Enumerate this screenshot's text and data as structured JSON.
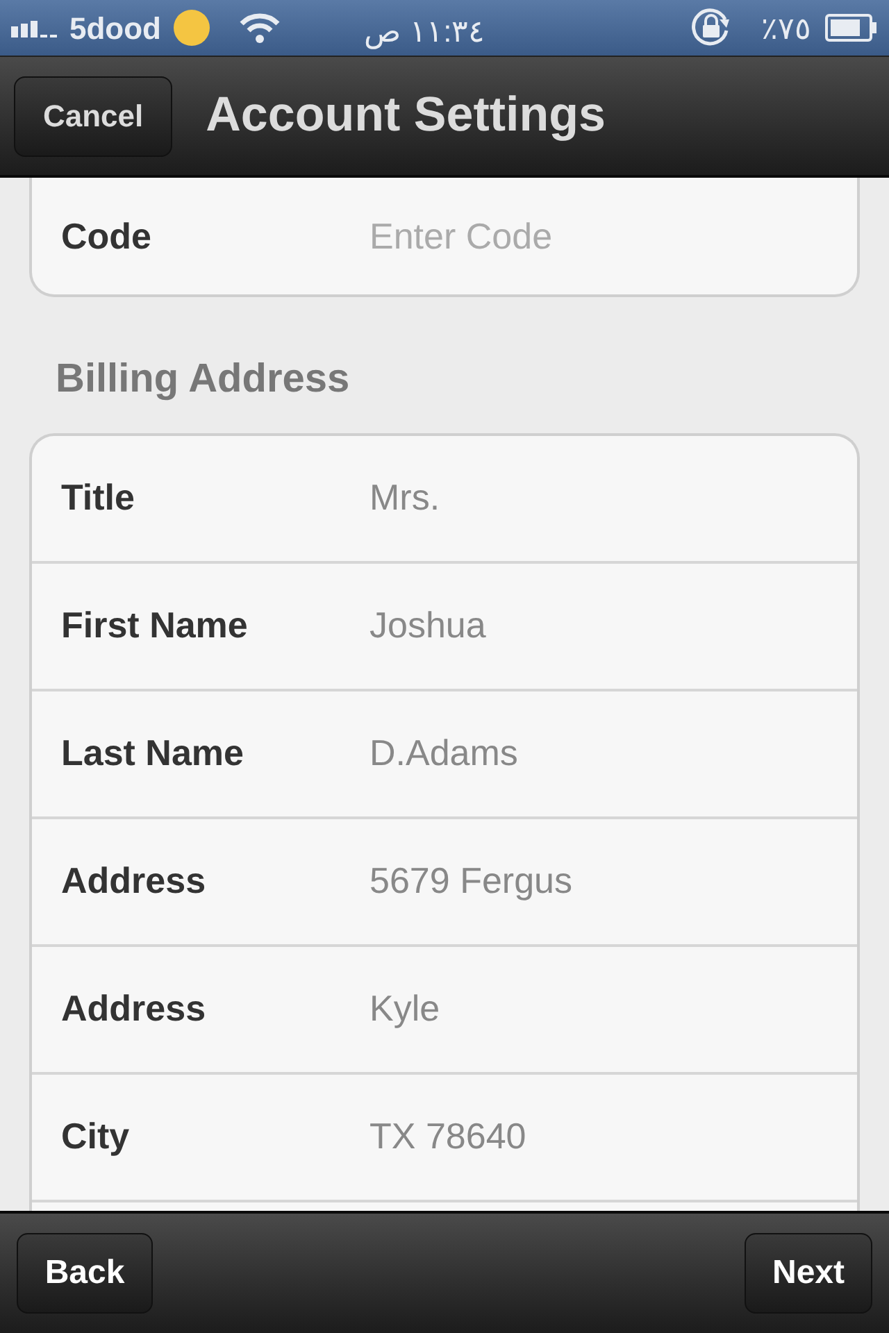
{
  "status_bar": {
    "carrier": "5dood",
    "time": "١١:٣٤ ص",
    "battery": "٪٧٥"
  },
  "nav_bar": {
    "cancel_button": "Cancel",
    "title": "Account Settings"
  },
  "code_section": {
    "fields": [
      {
        "label": "Code",
        "placeholder": "Enter Code"
      }
    ]
  },
  "billing_section": {
    "header": "Billing Address",
    "fields": [
      {
        "label": "Title",
        "value": "Mrs."
      },
      {
        "label": "First Name",
        "value": "Joshua"
      },
      {
        "label": "Last Name",
        "value": "D.Adams"
      },
      {
        "label": "Address",
        "value": "5679 Fergus"
      },
      {
        "label": "Address",
        "value": "Kyle"
      },
      {
        "label": "City",
        "value": "TX 78640"
      }
    ]
  },
  "toolbar": {
    "back_button": "Back",
    "next_button": "Next"
  }
}
